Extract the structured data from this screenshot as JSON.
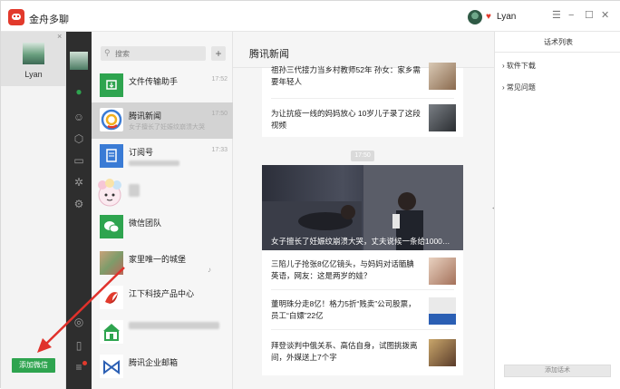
{
  "app": {
    "title": "金舟多聊"
  },
  "topbar": {
    "user": "Lyan",
    "window_controls": [
      "☰",
      "−",
      "☐",
      "✕"
    ]
  },
  "account": {
    "name": "Lyan",
    "close": "×",
    "add_button": "添加微信"
  },
  "nav_icons": [
    "chat-icon",
    "contacts-icon",
    "box-icon",
    "folder-icon",
    "settings-icon",
    "gear-icon",
    "moments-icon",
    "phone-icon",
    "menu-icon"
  ],
  "search": {
    "placeholder": "搜索",
    "add": "+"
  },
  "chats": [
    {
      "name": "文件传输助手",
      "time": "17:52",
      "snippet": ""
    },
    {
      "name": "腾讯新闻",
      "time": "17:50",
      "snippet": "女子擅长了妊娠纹崩溃大哭"
    },
    {
      "name": "订阅号",
      "time": "17:33",
      "snippet": ""
    },
    {
      "name": "",
      "time": "",
      "snippet": ""
    },
    {
      "name": "微信团队",
      "time": "",
      "snippet": ""
    },
    {
      "name": "家里唯一的城堡",
      "time": "",
      "snippet": ""
    },
    {
      "name": "江下科技产品中心",
      "time": "",
      "snippet": ""
    },
    {
      "name": "",
      "time": "",
      "snippet": ""
    },
    {
      "name": "腾讯企业邮箱",
      "time": "",
      "snippet": ""
    }
  ],
  "news": {
    "title": "腾讯新闻",
    "top_articles": [
      "祖孙三代接力当乡村教师52年 孙女：家乡需要年轻人",
      "为让抗疫一线的妈妈放心 10岁儿子录了这段视频"
    ],
    "time_sep": "17:50",
    "hero_caption": "女子擅长了妊娠纹崩溃大哭，丈夫说候一条给1000…",
    "articles": [
      "三陷儿子抢张8亿亿镜头，与妈妈对话腼腆英语，网友：这是两岁的娃？",
      "董明珠分走8亿！格力5折“贱卖”公司股票，员工“白嫖”22亿",
      "拜登谈判中俄关系、高估自身，试图挑拨离间，外媒送上7个字"
    ]
  },
  "scripts": {
    "title": "话术列表",
    "items": [
      "软件下载",
      "常见问题"
    ],
    "add_button": "添加话术"
  },
  "colors": {
    "brand_red": "#e23a2c",
    "wechat_green": "#2ea44f",
    "dark_nav": "#2e2e2e",
    "arrow_red": "#e0312b"
  }
}
